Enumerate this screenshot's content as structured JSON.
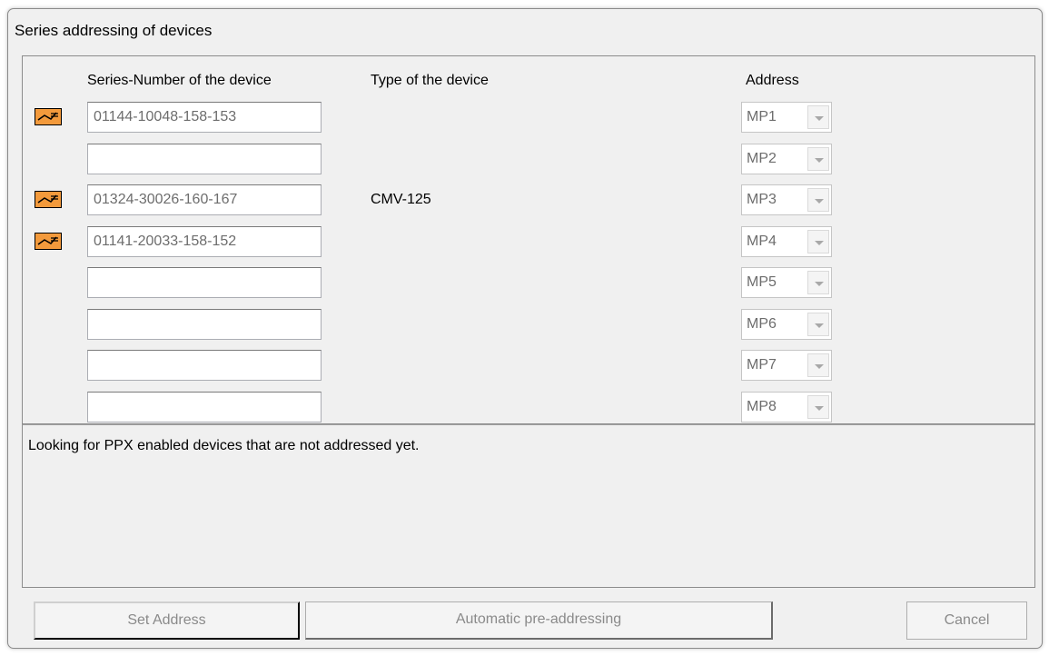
{
  "window": {
    "title": "Series addressing of devices"
  },
  "headers": {
    "serial": "Series-Number of the device",
    "type": "Type of the device",
    "address": "Address"
  },
  "rows": [
    {
      "serial": "01144-10048-158-153",
      "type": "",
      "address": "MP1",
      "icon": "device-connector-icon"
    },
    {
      "serial": "",
      "type": "",
      "address": "MP2",
      "icon": ""
    },
    {
      "serial": "01324-30026-160-167",
      "type": "CMV-125",
      "address": "MP3",
      "icon": "device-connector-icon"
    },
    {
      "serial": "01141-20033-158-152",
      "type": "",
      "address": "MP4",
      "icon": "device-connector-icon"
    },
    {
      "serial": "",
      "type": "",
      "address": "MP5",
      "icon": ""
    },
    {
      "serial": "",
      "type": "",
      "address": "MP6",
      "icon": ""
    },
    {
      "serial": "",
      "type": "",
      "address": "MP7",
      "icon": ""
    },
    {
      "serial": "",
      "type": "",
      "address": "MP8",
      "icon": ""
    }
  ],
  "status": {
    "message": "Looking for PPX enabled devices that are not addressed yet."
  },
  "buttons": {
    "set_address": "Set Address",
    "auto_preaddress": "Automatic pre-addressing",
    "cancel": "Cancel"
  },
  "colors": {
    "icon_fill": "#f39a3c",
    "icon_border": "#000000"
  }
}
